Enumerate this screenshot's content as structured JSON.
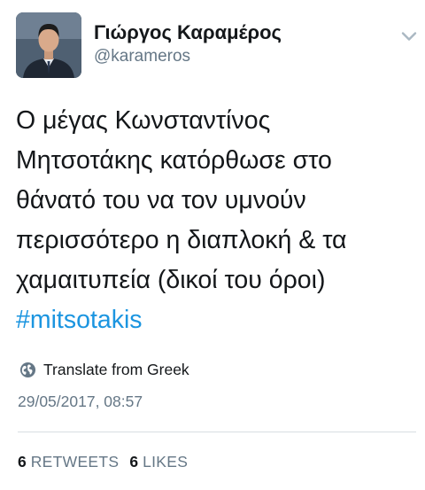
{
  "author": {
    "display_name": "Γιώργος Καραμέρος",
    "handle": "@karameros",
    "avatar_icon": "profile-photo"
  },
  "menu": {
    "icon": "chevron-down-icon"
  },
  "tweet": {
    "lines": [
      "Ο μέγας Κωνσταντίνος",
      "Μητσοτάκης κατόρθωσε στο",
      "θάνατό του να τον υμνούν",
      "περισσότερο η διαπλοκή & τα",
      "χαμαιτυπεία (δικοί του όροι)"
    ],
    "hashtag": "#mitsotakis"
  },
  "translate": {
    "label": "Translate from Greek",
    "icon": "globe-icon"
  },
  "timestamp": "29/05/2017, 08:57",
  "stats": {
    "retweets_count": "6",
    "retweets_label": "RETWEETS",
    "likes_count": "6",
    "likes_label": "LIKES"
  },
  "colors": {
    "text": "#14171a",
    "secondary": "#657786",
    "link": "#1b95e0",
    "divider": "#d8dde2",
    "background": "#ffffff"
  }
}
